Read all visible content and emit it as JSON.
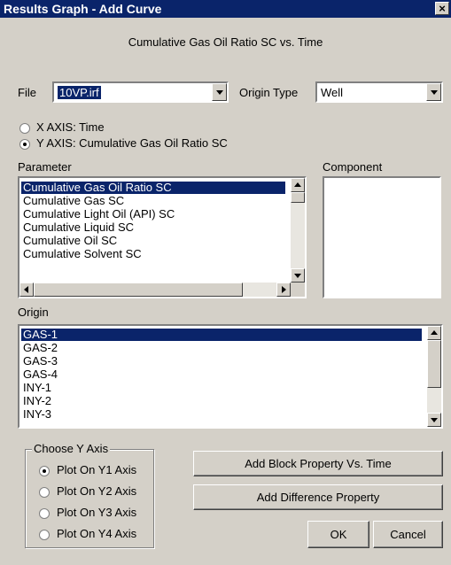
{
  "window": {
    "title": "Results Graph - Add Curve",
    "close_symbol": "×"
  },
  "heading": "Cumulative Gas Oil Ratio SC vs. Time",
  "file": {
    "label": "File",
    "value": "10VP.irf"
  },
  "origin_type": {
    "label": "Origin Type",
    "value": "Well"
  },
  "axis": {
    "x_label": "X AXIS: Time",
    "y_label": "Y AXIS: Cumulative Gas Oil Ratio SC",
    "selected": "y"
  },
  "parameter": {
    "label": "Parameter",
    "items": [
      "Cumulative Gas Oil Ratio SC",
      "Cumulative Gas SC",
      "Cumulative Light Oil (API) SC",
      "Cumulative Liquid SC",
      "Cumulative Oil SC",
      "Cumulative Solvent SC"
    ],
    "selected_index": 0
  },
  "component": {
    "label": "Component"
  },
  "origin": {
    "label": "Origin",
    "items": [
      "GAS-1",
      "GAS-2",
      "GAS-3",
      "GAS-4",
      "INY-1",
      "INY-2",
      "INY-3"
    ],
    "selected_index": 0
  },
  "choose_y_axis": {
    "label": "Choose Y Axis",
    "options": [
      "Plot On Y1 Axis",
      "Plot On Y2 Axis",
      "Plot On Y3 Axis",
      "Plot On Y4 Axis"
    ],
    "selected_index": 0
  },
  "buttons": {
    "add_block": "Add Block Property Vs. Time",
    "add_difference": "Add Difference Property",
    "ok": "OK",
    "cancel": "Cancel"
  },
  "colors": {
    "titlebar": "#0a246a",
    "face": "#d4d0c8",
    "selection": "#0a246a"
  }
}
